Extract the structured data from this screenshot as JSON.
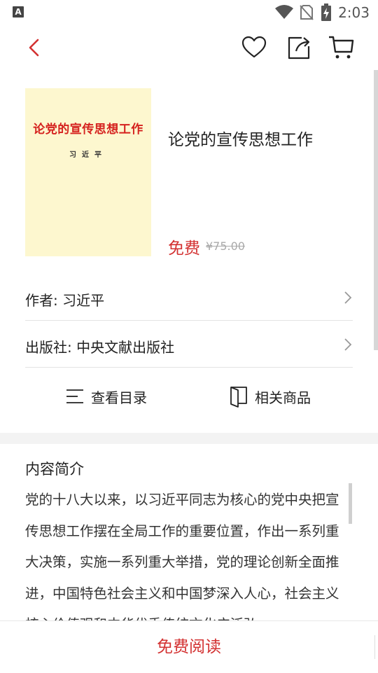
{
  "status_bar": {
    "app_indicator": "A",
    "time": "2:03",
    "icons": [
      "wifi-icon",
      "no-sim-icon",
      "battery-charging-icon"
    ]
  },
  "header": {
    "icons": [
      "back-icon",
      "favorite-heart-icon",
      "share-icon",
      "cart-icon"
    ],
    "accent_color": "#d33131"
  },
  "book": {
    "cover_title": "论党的宣传思想工作",
    "cover_author": "习近平",
    "title": "论党的宣传思想工作",
    "price_label": "免费",
    "original_price": "¥75.00"
  },
  "info": {
    "author": "作者: 习近平",
    "publisher": "出版社: 中央文献出版社"
  },
  "actions": {
    "toc": "查看目录",
    "related": "相关商品"
  },
  "intro": {
    "heading": "内容简介",
    "text": "党的十八大以来，以习近平同志为核心的党中央把宣传思想工作摆在全局工作的重要位置，作出一系列重大决策，实施一系列重大举措，党的理论创新全面推进，中国特色社会主义和中国梦深入人心，社会主义核心价值观和中华优秀传统文化广泛弘"
  },
  "bottom": {
    "read_button": "免费阅读"
  }
}
